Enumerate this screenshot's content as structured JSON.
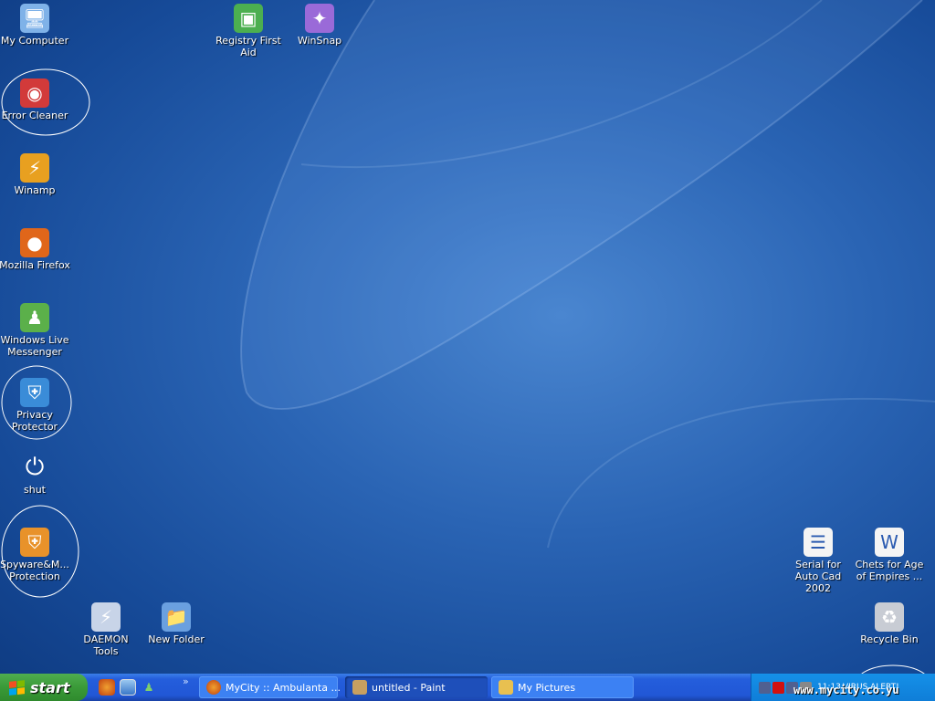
{
  "desktop_icons": [
    {
      "label": "My Computer",
      "icon": "computer-icon",
      "color": "#7fb2e8"
    },
    {
      "label": "Error Cleaner",
      "icon": "shield-magnifier-icon",
      "color": "#d23a3a"
    },
    {
      "label": "Winamp",
      "icon": "winamp-bolt-icon",
      "color": "#e8a020"
    },
    {
      "label": "Mozilla Firefox",
      "icon": "firefox-icon",
      "color": "#e0661a"
    },
    {
      "label": "Windows Live Messenger",
      "icon": "messenger-buddies-icon",
      "color": "#5bb04a"
    },
    {
      "label": "Privacy Protector",
      "icon": "shield-icon",
      "color": "#3a8cd8"
    },
    {
      "label": "shut",
      "icon": "power-icon",
      "color": "transparent"
    },
    {
      "label": "Spyware&M... Protection",
      "icon": "shield-icon",
      "color": "#e8922a"
    },
    {
      "label": "DAEMON Tools",
      "icon": "daemon-bolt-icon",
      "color": "#c8d4e8"
    },
    {
      "label": "New Folder",
      "icon": "folder-icon",
      "color": "#6aa0e0"
    },
    {
      "label": "Registry First Aid",
      "icon": "registry-cube-icon",
      "color": "#4caf50"
    },
    {
      "label": "WinSnap",
      "icon": "winsnap-icon",
      "color": "#9a6ad8"
    },
    {
      "label": "Serial for Auto Cad 2002",
      "icon": "text-document-icon",
      "color": "#f4f4f4"
    },
    {
      "label": "Chets for Age of Empires ...",
      "icon": "word-document-icon",
      "color": "#f4f4f4"
    },
    {
      "label": "Recycle Bin",
      "icon": "recycle-bin-icon",
      "color": "#c8ccd4"
    }
  ],
  "taskbar": {
    "start_label": "start",
    "quick_launch": [
      "firefox-icon",
      "show-desktop-icon",
      "messenger-icon"
    ],
    "overflow": "»",
    "tasks": [
      {
        "label": "MyCity :: Ambulanta ...",
        "icon": "firefox-icon",
        "color": "#e0661a",
        "state": "normal"
      },
      {
        "label": "untitled - Paint",
        "icon": "paint-icon",
        "color": "#c8a060",
        "state": "active"
      },
      {
        "label": "My Pictures",
        "icon": "pictures-folder-icon",
        "color": "#e8c050",
        "state": "normal"
      }
    ],
    "tray": {
      "clock": "11:13",
      "alert": "VIRUS ALERT!",
      "watermark": "www.mycity.co.yu"
    }
  }
}
